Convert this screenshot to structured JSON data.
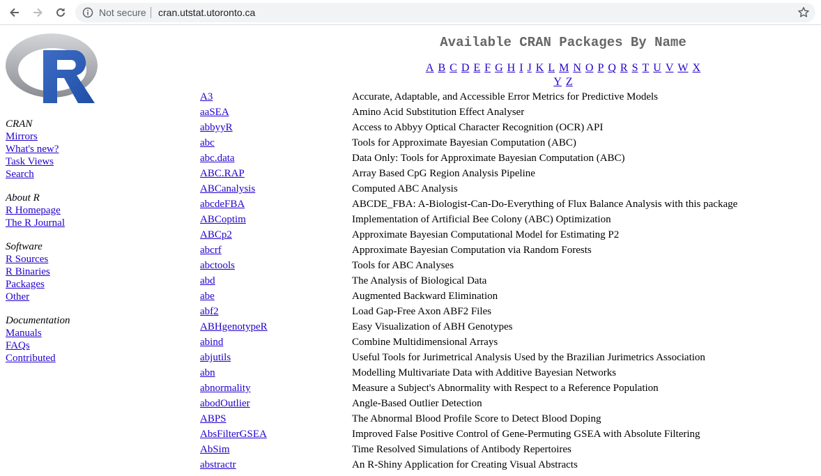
{
  "browser": {
    "security_label": "Not secure",
    "url": "cran.utstat.utoronto.ca",
    "icons": [
      "back-icon",
      "forward-icon",
      "reload-icon",
      "info-icon",
      "star-icon"
    ]
  },
  "sidebar": {
    "groups": [
      {
        "heading": "CRAN",
        "links": [
          "Mirrors",
          "What's new?",
          "Task Views",
          "Search"
        ]
      },
      {
        "heading": "About R",
        "links": [
          "R Homepage",
          "The R Journal"
        ]
      },
      {
        "heading": "Software",
        "links": [
          "R Sources",
          "R Binaries",
          "Packages",
          "Other"
        ]
      },
      {
        "heading": "Documentation",
        "links": [
          "Manuals",
          "FAQs",
          "Contributed"
        ]
      }
    ]
  },
  "main": {
    "title": "Available CRAN Packages By Name",
    "letters": [
      "A",
      "B",
      "C",
      "D",
      "E",
      "F",
      "G",
      "H",
      "I",
      "J",
      "K",
      "L",
      "M",
      "N",
      "O",
      "P",
      "Q",
      "R",
      "S",
      "T",
      "U",
      "V",
      "W",
      "X",
      "Y",
      "Z"
    ],
    "packages": [
      {
        "name": "A3",
        "title": "Accurate, Adaptable, and Accessible Error Metrics for Predictive Models"
      },
      {
        "name": "aaSEA",
        "title": "Amino Acid Substitution Effect Analyser"
      },
      {
        "name": "abbyyR",
        "title": "Access to Abbyy Optical Character Recognition (OCR) API"
      },
      {
        "name": "abc",
        "title": "Tools for Approximate Bayesian Computation (ABC)"
      },
      {
        "name": "abc.data",
        "title": "Data Only: Tools for Approximate Bayesian Computation (ABC)"
      },
      {
        "name": "ABC.RAP",
        "title": "Array Based CpG Region Analysis Pipeline"
      },
      {
        "name": "ABCanalysis",
        "title": "Computed ABC Analysis"
      },
      {
        "name": "abcdeFBA",
        "title": "ABCDE_FBA: A-Biologist-Can-Do-Everything of Flux Balance Analysis with this package"
      },
      {
        "name": "ABCoptim",
        "title": "Implementation of Artificial Bee Colony (ABC) Optimization"
      },
      {
        "name": "ABCp2",
        "title": "Approximate Bayesian Computational Model for Estimating P2"
      },
      {
        "name": "abcrf",
        "title": "Approximate Bayesian Computation via Random Forests"
      },
      {
        "name": "abctools",
        "title": "Tools for ABC Analyses"
      },
      {
        "name": "abd",
        "title": "The Analysis of Biological Data"
      },
      {
        "name": "abe",
        "title": "Augmented Backward Elimination"
      },
      {
        "name": "abf2",
        "title": "Load Gap-Free Axon ABF2 Files"
      },
      {
        "name": "ABHgenotypeR",
        "title": "Easy Visualization of ABH Genotypes"
      },
      {
        "name": "abind",
        "title": "Combine Multidimensional Arrays"
      },
      {
        "name": "abjutils",
        "title": "Useful Tools for Jurimetrical Analysis Used by the Brazilian Jurimetrics Association"
      },
      {
        "name": "abn",
        "title": "Modelling Multivariate Data with Additive Bayesian Networks"
      },
      {
        "name": "abnormality",
        "title": "Measure a Subject's Abnormality with Respect to a Reference Population"
      },
      {
        "name": "abodOutlier",
        "title": "Angle-Based Outlier Detection"
      },
      {
        "name": "ABPS",
        "title": "The Abnormal Blood Profile Score to Detect Blood Doping"
      },
      {
        "name": "AbsFilterGSEA",
        "title": "Improved False Positive Control of Gene-Permuting GSEA with Absolute Filtering"
      },
      {
        "name": "AbSim",
        "title": "Time Resolved Simulations of Antibody Repertoires"
      },
      {
        "name": "abstractr",
        "title": "An R-Shiny Application for Creating Visual Abstracts"
      }
    ]
  },
  "colors": {
    "link": "#2200cc",
    "title_gray": "#666666",
    "logo_blue": "#2a5bb3",
    "omnibox_bg": "#f1f3f4"
  }
}
